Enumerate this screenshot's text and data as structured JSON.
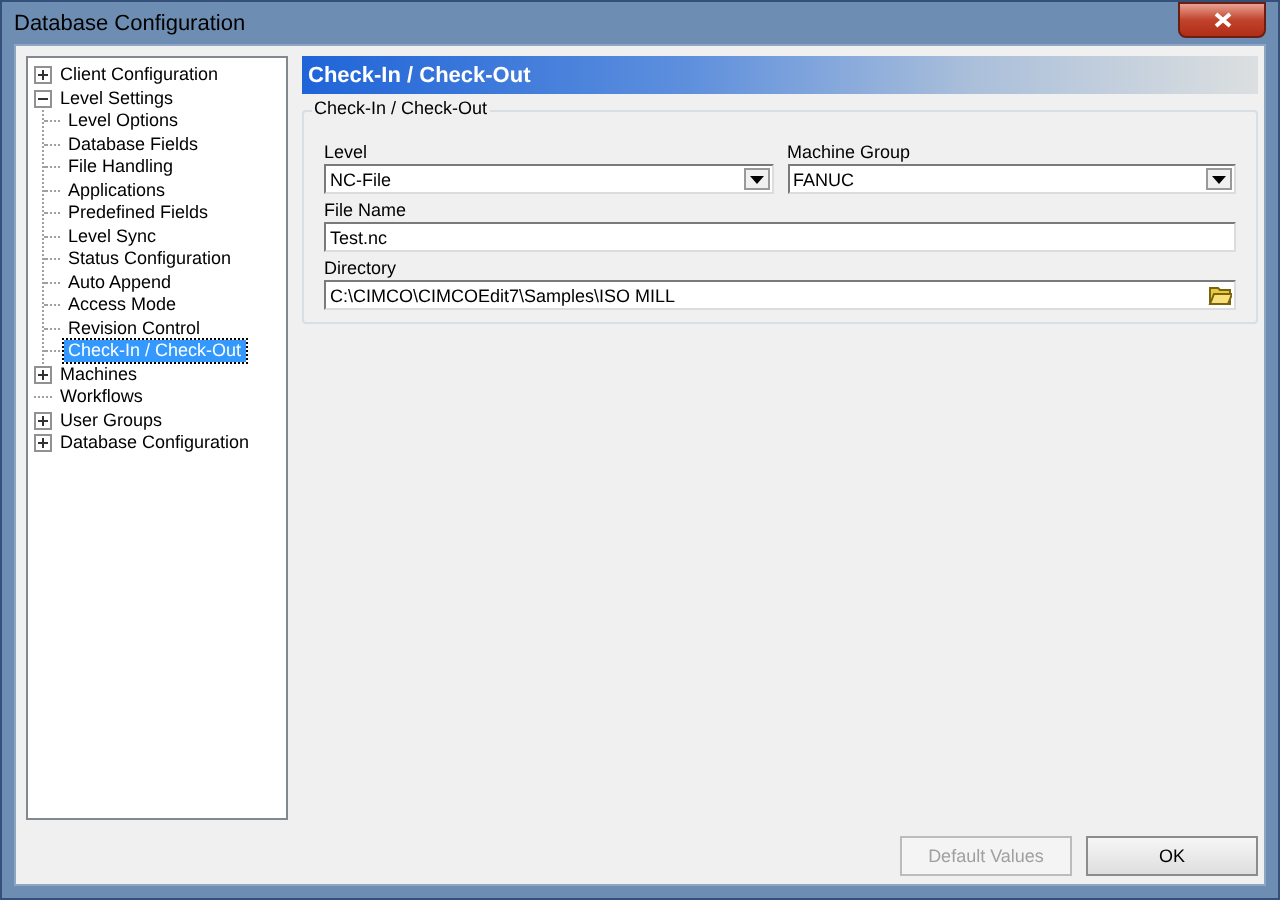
{
  "window": {
    "title": "Database Configuration"
  },
  "tree": [
    {
      "label": "Client Configuration",
      "kind": "node",
      "expanded": false,
      "selected": false
    },
    {
      "label": "Level Settings",
      "kind": "node",
      "expanded": true,
      "selected": false,
      "children": [
        {
          "label": "Level Options",
          "selected": false
        },
        {
          "label": "Database Fields",
          "selected": false
        },
        {
          "label": "File Handling",
          "selected": false
        },
        {
          "label": "Applications",
          "selected": false
        },
        {
          "label": "Predefined Fields",
          "selected": false
        },
        {
          "label": "Level Sync",
          "selected": false
        },
        {
          "label": "Status Configuration",
          "selected": false
        },
        {
          "label": "Auto Append",
          "selected": false
        },
        {
          "label": "Access Mode",
          "selected": false
        },
        {
          "label": "Revision Control",
          "selected": false
        },
        {
          "label": "Check-In / Check-Out",
          "selected": true
        }
      ]
    },
    {
      "label": "Machines",
      "kind": "node",
      "expanded": false,
      "selected": false
    },
    {
      "label": "Workflows",
      "kind": "leaf",
      "selected": false
    },
    {
      "label": "User Groups",
      "kind": "node",
      "expanded": false,
      "selected": false
    },
    {
      "label": "Database Configuration",
      "kind": "node",
      "expanded": false,
      "selected": false
    }
  ],
  "panel": {
    "header": "Check-In / Check-Out",
    "group_title": "Check-In / Check-Out",
    "level": {
      "label": "Level",
      "value": "NC-File"
    },
    "machine_group": {
      "label": "Machine Group",
      "value": "FANUC"
    },
    "file_name": {
      "label": "File Name",
      "value": "Test.nc"
    },
    "directory": {
      "label": "Directory",
      "value": "C:\\CIMCO\\CIMCOEdit7\\Samples\\ISO MILL"
    }
  },
  "buttons": [
    {
      "label": "Default Values",
      "disabled": true
    },
    {
      "label": "OK",
      "disabled": false
    }
  ]
}
